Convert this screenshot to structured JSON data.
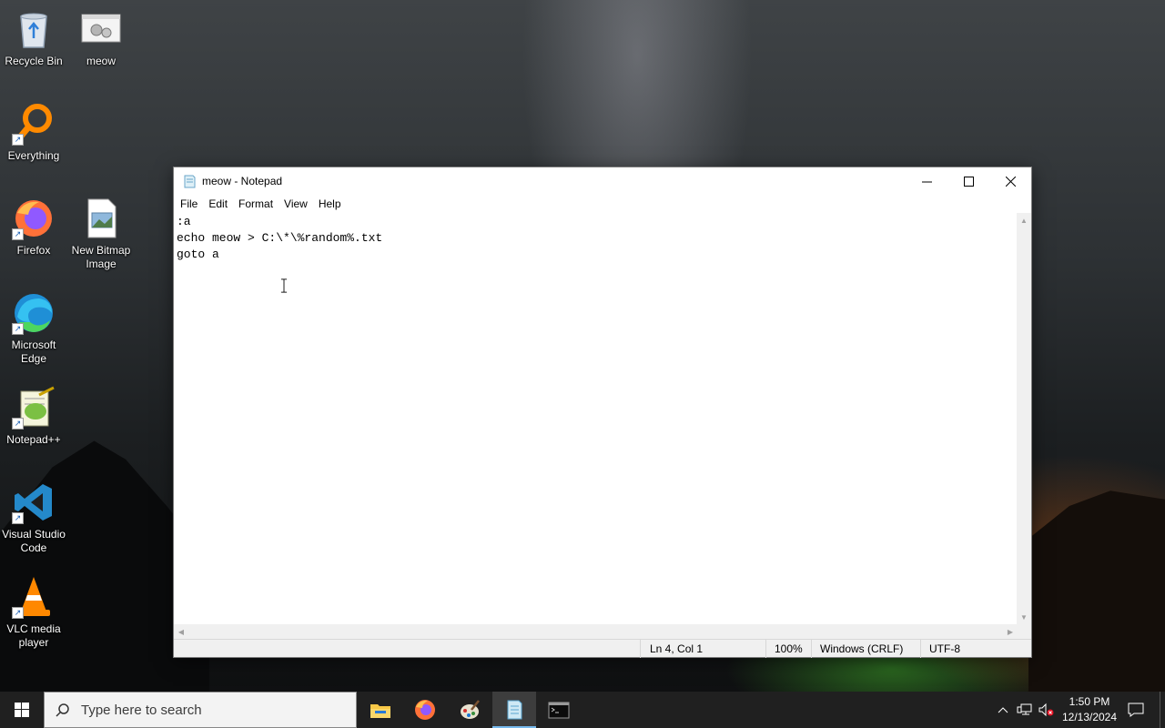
{
  "desktop": {
    "icons": [
      {
        "label": "Recycle Bin",
        "icon": "recycle-bin-icon"
      },
      {
        "label": "meow",
        "icon": "batch-file-icon"
      },
      {
        "label": "Everything",
        "icon": "everything-search-icon"
      },
      {
        "label": "Firefox",
        "icon": "firefox-icon"
      },
      {
        "label": "New Bitmap Image",
        "icon": "bitmap-image-icon"
      },
      {
        "label": "Microsoft Edge",
        "icon": "edge-icon"
      },
      {
        "label": "Notepad++",
        "icon": "notepad-plus-plus-icon"
      },
      {
        "label": "Visual Studio Code",
        "icon": "vscode-icon"
      },
      {
        "label": "VLC media player",
        "icon": "vlc-icon"
      }
    ]
  },
  "notepad": {
    "title": "meow - Notepad",
    "menu": [
      "File",
      "Edit",
      "Format",
      "View",
      "Help"
    ],
    "content": ":a\necho meow > C:\\*\\%random%.txt\ngoto a",
    "status": {
      "position": "Ln 4, Col 1",
      "zoom": "100%",
      "line_endings": "Windows (CRLF)",
      "encoding": "UTF-8"
    }
  },
  "taskbar": {
    "search_placeholder": "Type here to search",
    "apps": [
      "file-explorer-icon",
      "firefox-icon",
      "paint-icon",
      "notepad-icon",
      "terminal-icon"
    ],
    "active_app": "notepad-icon",
    "time": "1:50 PM",
    "date": "12/13/2024"
  },
  "colors": {
    "taskbar_bg": "#202020",
    "accent": "#76b9ed",
    "window_border": "#7a7a7a"
  }
}
